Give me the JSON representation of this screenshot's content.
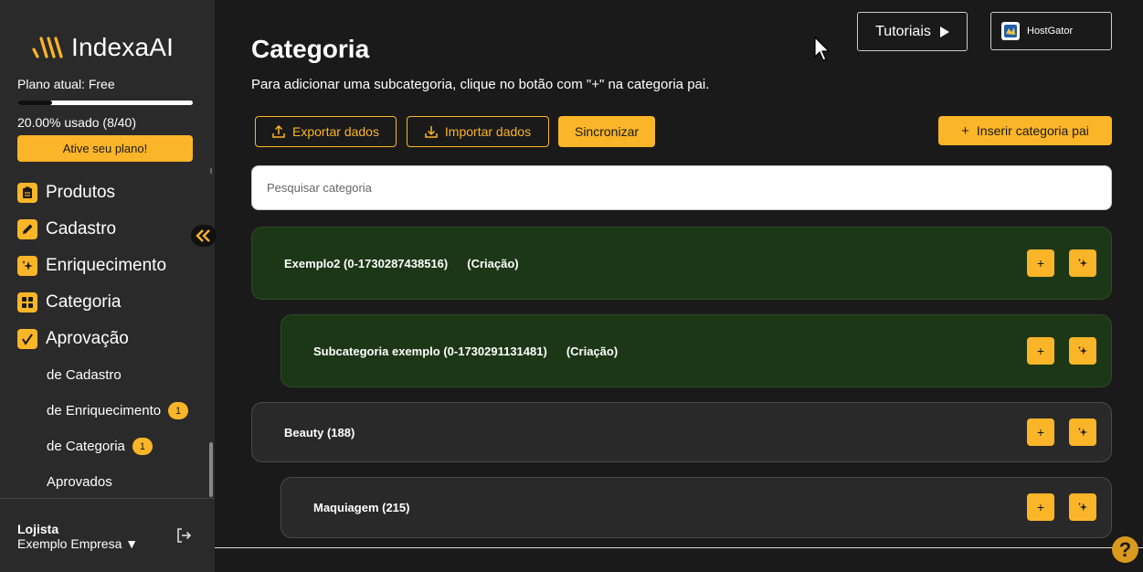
{
  "brand": {
    "name": "IndexaAI"
  },
  "plan": {
    "label": "Plano atual: Free",
    "usage_text": "20.00% usado (8/40)",
    "usage_fraction": 0.2,
    "activate_label": "Ative seu plano!"
  },
  "nav": {
    "items": [
      {
        "label": "Produtos",
        "icon": "clipboard-icon"
      },
      {
        "label": "Cadastro",
        "icon": "pencil-icon"
      },
      {
        "label": "Enriquecimento",
        "icon": "sparkle-icon"
      },
      {
        "label": "Categoria",
        "icon": "grid-icon"
      },
      {
        "label": "Aprovação",
        "icon": "check-icon"
      }
    ],
    "approval_sub": [
      {
        "label": "de Cadastro",
        "badge": ""
      },
      {
        "label": "de Enriquecimento",
        "badge": "1"
      },
      {
        "label": "de Categoria",
        "badge": "1"
      },
      {
        "label": "Aprovados",
        "badge": ""
      }
    ]
  },
  "user": {
    "role": "Lojista",
    "company": "Exemplo Empresa ▼"
  },
  "header": {
    "title": "Categoria",
    "description": "Para adicionar uma subcategoria, clique no botão com \"+\" na categoria pai.",
    "tutorials_label": "Tutoriais",
    "store_label": "HostGator"
  },
  "toolbar": {
    "export_label": "Exportar dados",
    "import_label": "Importar dados",
    "sync_label": "Sincronizar",
    "insert_parent_label": "Inserir categoria pai"
  },
  "search": {
    "placeholder": "Pesquisar categoria"
  },
  "categories": [
    {
      "name": "Exemplo2 (0-1730287438516)",
      "status": "(Criação)",
      "level": 0,
      "color": "#1c3716"
    },
    {
      "name": "Subcategoria exemplo (0-1730291131481)",
      "status": "(Criação)",
      "level": 1,
      "color": "#1c3716"
    },
    {
      "name": "Beauty (188)",
      "status": "",
      "level": 0,
      "color": "#2a2929"
    },
    {
      "name": "Maquiagem (215)",
      "status": "",
      "level": 1,
      "color": "#2a2929"
    }
  ],
  "colors": {
    "accent": "#fbb528",
    "background": "#1a1a1a",
    "sidebar": "#2b2a2a",
    "new_category": "#1c3716"
  },
  "help": {
    "label": "?"
  }
}
